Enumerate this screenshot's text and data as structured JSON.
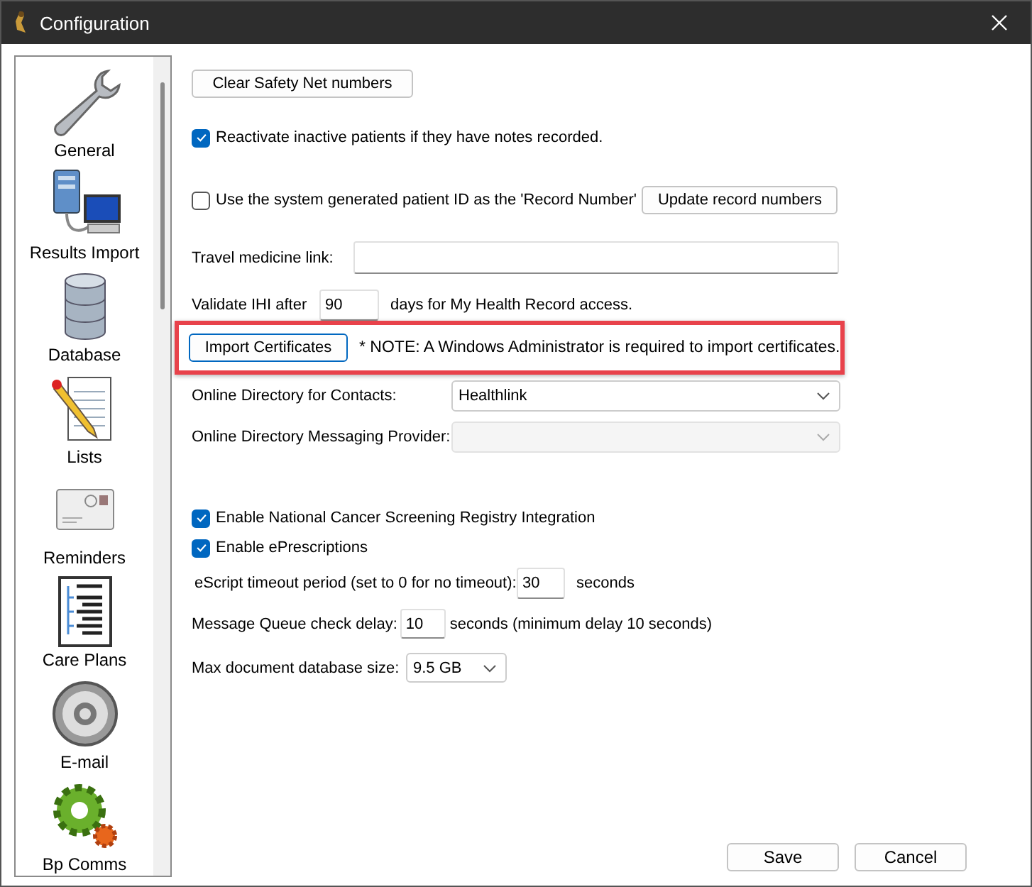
{
  "window": {
    "title": "Configuration"
  },
  "sidebar": {
    "items": [
      {
        "label": "General"
      },
      {
        "label": "Results Import"
      },
      {
        "label": "Database"
      },
      {
        "label": "Lists"
      },
      {
        "label": "Reminders"
      },
      {
        "label": "Care Plans"
      },
      {
        "label": "E-mail"
      },
      {
        "label": "Bp Comms"
      }
    ]
  },
  "clear_button": "Clear Safety Net numbers",
  "reactivate": {
    "label": "Reactivate inactive patients if they have notes recorded.",
    "checked": true
  },
  "system_id": {
    "label": "Use the system generated patient ID as the 'Record Number'",
    "checked": false,
    "button": "Update record numbers"
  },
  "travel_link": {
    "label": "Travel medicine link:"
  },
  "validate_ihi": {
    "label": "Validate IHI after",
    "value": "90",
    "suffix": "days for My Health Record access."
  },
  "import": {
    "button": "Import Certificates",
    "note": "* NOTE: A Windows Administrator is required to import certificates."
  },
  "directory": {
    "label": "Online Directory for Contacts:",
    "value": "Healthlink",
    "disabled": false
  },
  "messaging": {
    "label": "Online Directory Messaging Provider:",
    "disabled": true
  },
  "ncsr": {
    "label": "Enable National Cancer Screening Registry Integration",
    "checked": true
  },
  "eprescriptions": {
    "label": "Enable ePrescriptions",
    "checked": true
  },
  "escript_timeout": {
    "label": "eScript timeout period (set to 0 for no timeout):",
    "value": "30",
    "suffix": "seconds"
  },
  "queue_delay": {
    "label": "Message Queue check delay:",
    "value": "10",
    "suffix": "seconds (minimum delay 10 seconds)"
  },
  "max_size": {
    "label": "Max document database size:",
    "value": "9.5 GB"
  },
  "buttons": [
    "Save",
    "Cancel"
  ]
}
